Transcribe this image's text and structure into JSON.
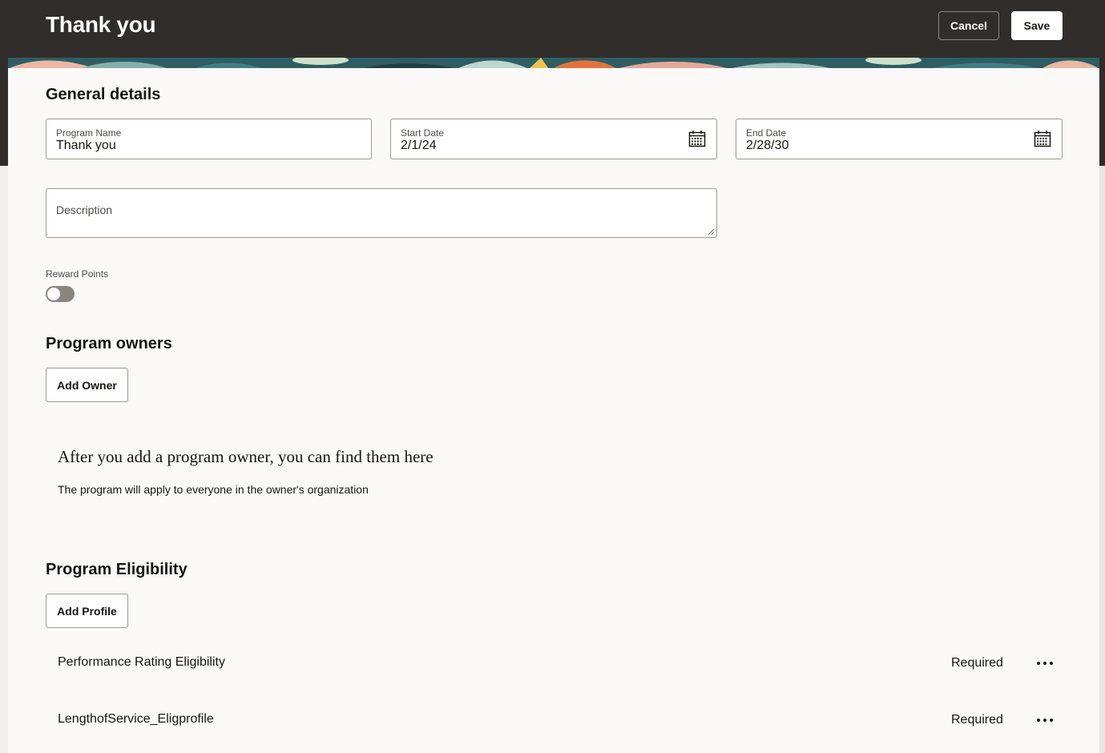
{
  "header": {
    "title": "Thank you",
    "cancel_label": "Cancel",
    "save_label": "Save"
  },
  "general": {
    "title": "General details",
    "program_name": {
      "label": "Program Name",
      "value": "Thank you"
    },
    "start_date": {
      "label": "Start Date",
      "value": "2/1/24",
      "icon": "calendar-icon"
    },
    "end_date": {
      "label": "End Date",
      "value": "2/28/30",
      "icon": "calendar-icon"
    },
    "description": {
      "label": "Description",
      "value": ""
    },
    "reward_points": {
      "label": "Reward Points",
      "enabled": false
    }
  },
  "owners": {
    "title": "Program owners",
    "add_label": "Add Owner",
    "empty_title": "After you add a program owner, you can find them here",
    "empty_subtitle": "The program will apply to everyone in the owner's organization"
  },
  "eligibility": {
    "title": "Program Eligibility",
    "add_label": "Add Profile",
    "rows": [
      {
        "name": "Performance Rating Eligibility",
        "status": "Required",
        "icon": "more-options-icon"
      },
      {
        "name": "LengthofService_Eligprofile",
        "status": "Required",
        "icon": "more-options-icon"
      }
    ]
  },
  "colors": {
    "header_bg": "#312d2a",
    "page_bg": "#faf9f8",
    "toggle_off": "#8a857f"
  }
}
